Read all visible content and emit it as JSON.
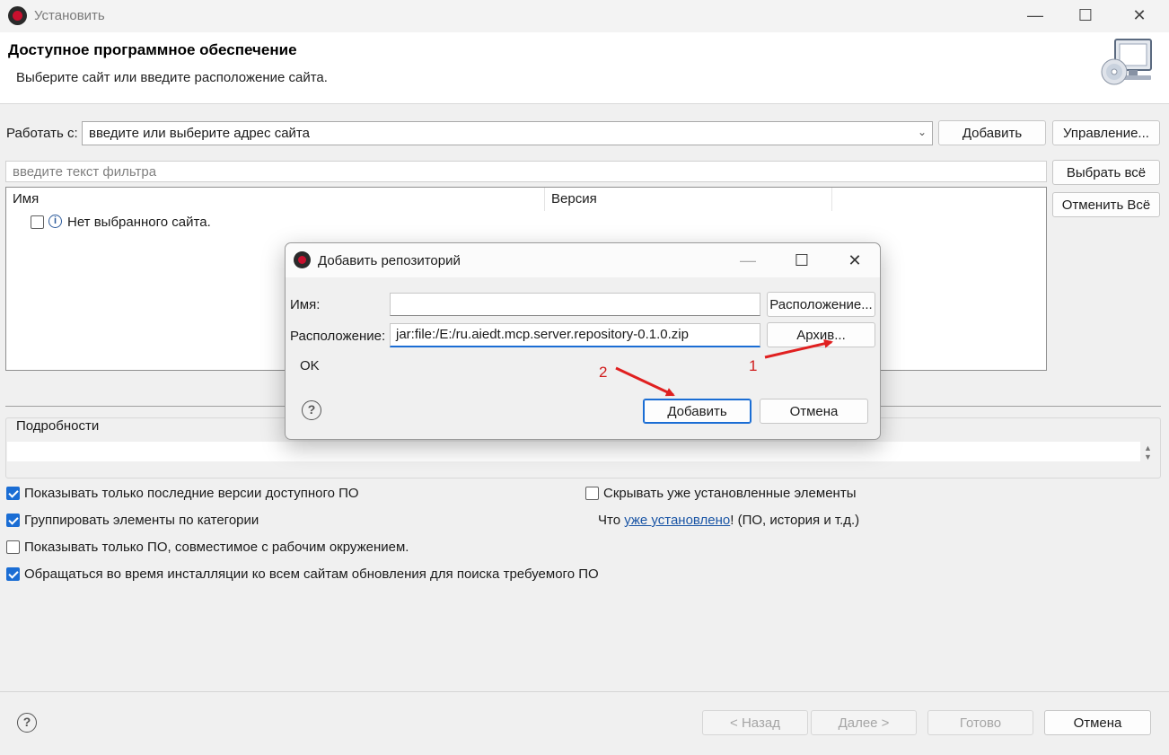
{
  "window": {
    "title": "Установить",
    "minimize": "—",
    "maximize": "☐",
    "close": "✕"
  },
  "header": {
    "title": "Доступное программное обеспечение",
    "subtitle": "Выберите сайт или введите расположение сайта."
  },
  "work_with": {
    "label": "Работать с:",
    "value": "введите или выберите адрес сайта",
    "add_label": "Добавить",
    "manage_label": "Управление..."
  },
  "filter": {
    "placeholder": "введите текст фильтра"
  },
  "side_buttons": {
    "select_all": "Выбрать всё",
    "deselect_all": "Отменить Всё"
  },
  "table": {
    "columns": [
      "Имя",
      "Версия"
    ],
    "rows": [
      {
        "name": "Нет выбранного сайта."
      }
    ]
  },
  "details": {
    "label": "Подробности"
  },
  "options": {
    "show_latest": {
      "label": "Показывать только последние версии доступного ПО",
      "checked": true
    },
    "group_by_category": {
      "label": "Группировать элементы по категории",
      "checked": true
    },
    "show_compatible": {
      "label": "Показывать только ПО, совместимое с рабочим окружением.",
      "checked": false
    },
    "contact_all_sites": {
      "label": "Обращаться во время инсталляции ко всем сайтам обновления для поиска требуемого ПО",
      "checked": true
    },
    "hide_installed": {
      "label": "Скрывать уже установленные элементы",
      "checked": false
    },
    "installed_prefix": "Что ",
    "installed_link": "уже установлено",
    "installed_suffix": "! (ПО, история и т.д.)"
  },
  "footer": {
    "back": "< Назад",
    "next": "Далее >",
    "finish": "Готово",
    "cancel": "Отмена",
    "help": "?"
  },
  "dialog": {
    "title": "Добавить репозиторий",
    "minimize": "—",
    "maximize": "☐",
    "close": "✕",
    "name_label": "Имя:",
    "name_value": "",
    "location_label": "Расположение:",
    "location_value": "jar:file:/E:/ru.aiedt.mcp.server.repository-0.1.0.zip",
    "local_button": "Расположение...",
    "archive_button": "Архив...",
    "status": "OK",
    "help": "?",
    "add_button": "Добавить",
    "cancel_button": "Отмена"
  },
  "annotations": {
    "step1": "1",
    "step2": "2",
    "arrow_color": "#e02020"
  },
  "colors": {
    "accent": "#1a6dd4",
    "link": "#1a55a5",
    "app_icon_red": "#c8102e"
  }
}
